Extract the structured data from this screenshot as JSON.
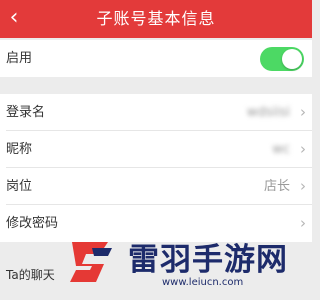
{
  "header": {
    "title": "子账号基本信息"
  },
  "rows": {
    "enable": {
      "label": "启用",
      "toggle_on": true
    },
    "login_name": {
      "label": "登录名",
      "value": "wdsiisi"
    },
    "nickname": {
      "label": "昵称",
      "value": "wc"
    },
    "position": {
      "label": "岗位",
      "value": "店长"
    },
    "change_password": {
      "label": "修改密码"
    }
  },
  "section": {
    "title": "Ta的聊天"
  },
  "watermark": {
    "name": "雷羽手游网",
    "url": "www.leiucn.com"
  },
  "colors": {
    "header_bg": "#e33a3a",
    "toggle_on": "#4cd964",
    "watermark": "#1d2b6b"
  }
}
